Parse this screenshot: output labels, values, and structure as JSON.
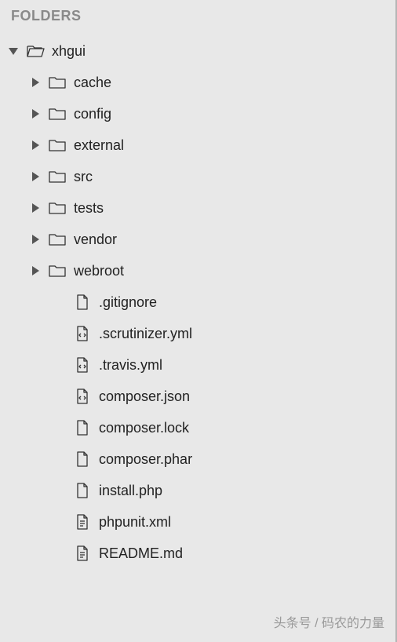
{
  "header": {
    "title": "FOLDERS"
  },
  "tree": {
    "root": {
      "name": "xhgui",
      "expanded": true,
      "folders": [
        {
          "name": "cache",
          "expanded": false
        },
        {
          "name": "config",
          "expanded": false
        },
        {
          "name": "external",
          "expanded": false
        },
        {
          "name": "src",
          "expanded": false
        },
        {
          "name": "tests",
          "expanded": false
        },
        {
          "name": "vendor",
          "expanded": false
        },
        {
          "name": "webroot",
          "expanded": false
        }
      ],
      "files": [
        {
          "name": ".gitignore",
          "icon": "file"
        },
        {
          "name": ".scrutinizer.yml",
          "icon": "code"
        },
        {
          "name": ".travis.yml",
          "icon": "code"
        },
        {
          "name": "composer.json",
          "icon": "code"
        },
        {
          "name": "composer.lock",
          "icon": "file"
        },
        {
          "name": "composer.phar",
          "icon": "file"
        },
        {
          "name": "install.php",
          "icon": "file"
        },
        {
          "name": "phpunit.xml",
          "icon": "lines"
        },
        {
          "name": "README.md",
          "icon": "lines"
        }
      ]
    }
  },
  "watermark": "头条号 / 码农的力量"
}
